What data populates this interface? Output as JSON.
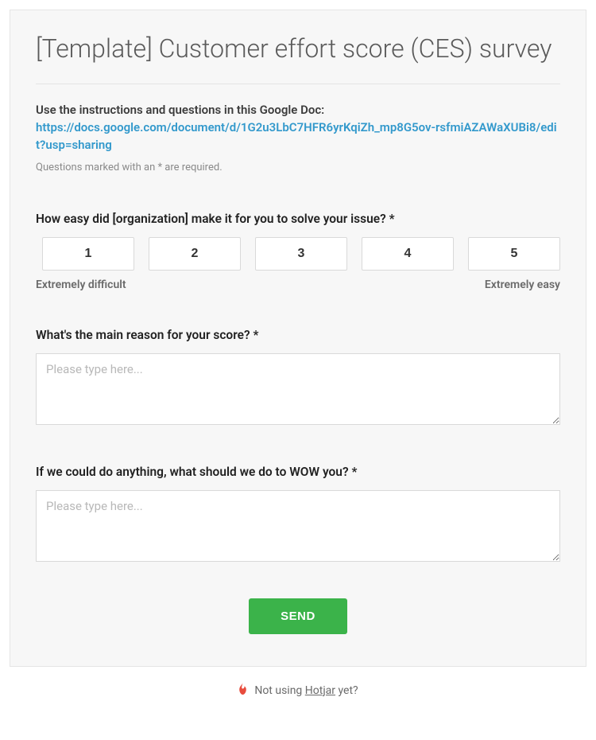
{
  "survey": {
    "title": "[Template] Customer effort score (CES) survey",
    "intro": "Use the instructions and questions in this Google Doc:",
    "doc_link": "https://docs.google.com/document/d/1G2u3LbC7HFR6yrKqiZh_mp8G5ov-rsfmiAZAWaXUBi8/edit?usp=sharing",
    "required_note": "Questions marked with an * are required.",
    "q1": {
      "label": "How easy did [organization] make it for you to solve your issue? *",
      "options": [
        "1",
        "2",
        "3",
        "4",
        "5"
      ],
      "caption_low": "Extremely difficult",
      "caption_high": "Extremely easy"
    },
    "q2": {
      "label": "What's the main reason for your score? *",
      "placeholder": "Please type here..."
    },
    "q3": {
      "label": "If we could do anything, what should we do to WOW you? *",
      "placeholder": "Please type here..."
    },
    "send_label": "SEND"
  },
  "footer": {
    "prefix": "Not using ",
    "brand": "Hotjar",
    "suffix": " yet?"
  }
}
